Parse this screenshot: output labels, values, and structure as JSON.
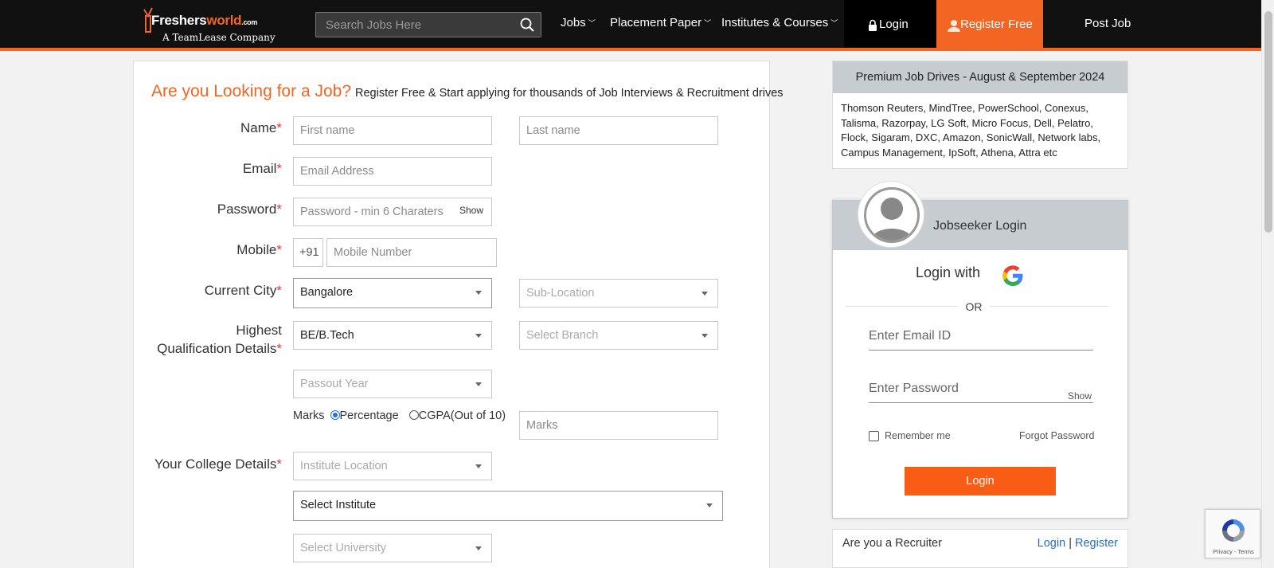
{
  "header": {
    "logo_brand_a": "Freshers",
    "logo_brand_b": "world",
    "logo_brand_c": ".com",
    "logo_tagline": "A TeamLease Company",
    "search_placeholder": "Search Jobs Here",
    "nav": {
      "jobs": "Jobs",
      "placement": "Placement Paper",
      "institutes": "Institutes & Courses",
      "login": "Login",
      "register": "Register Free",
      "post_job": "Post Job"
    },
    "accent_color": "#f26522"
  },
  "form": {
    "headline": "Are you Looking for a Job?",
    "subheadline": "Register Free & Start applying for thousands of Job Interviews & Recruitment drives",
    "required_mark": "*",
    "name_label": "Name",
    "first_name_placeholder": "First name",
    "last_name_placeholder": "Last name",
    "email_label": "Email",
    "email_placeholder": "Email Address",
    "password_label": "Password",
    "password_placeholder": "Password - min 6 Charaters",
    "password_show": "Show",
    "mobile_label": "Mobile",
    "mobile_prefix": "+91",
    "mobile_placeholder": "Mobile Number",
    "city_label": "Current City",
    "city_value": "Bangalore",
    "sublocation_placeholder": "Sub-Location",
    "qualification_label_1": "Highest",
    "qualification_label_2": "Qualification Details",
    "qualification_value": "BE/B.Tech",
    "branch_placeholder": "Select Branch",
    "passout_placeholder": "Passout Year",
    "marks_label": "Marks",
    "marks_option_percentage": "Percentage",
    "marks_option_cgpa": "CGPA(Out of 10)",
    "marks_selected": "Percentage",
    "marks_placeholder": "Marks",
    "college_label": "Your College Details",
    "institute_location_placeholder": "Institute Location",
    "institute_value": "Select Institute",
    "university_placeholder": "Select University"
  },
  "sidebar": {
    "drives_title": "Premium Job Drives - August & September 2024",
    "drives_text": "Thomson Reuters, MindTree, PowerSchool, Conexus, Talisma, Razorpay, LG Soft, Micro Focus, Dell, Pelatro, Flock, Sigaram, DXC, Amazon, SonicWall, Network labs, Campus Management, IpSoft, Athena, Attra etc",
    "login_title": "Jobseeker Login",
    "login_with": "Login with",
    "or": "OR",
    "email_placeholder": "Enter Email ID",
    "password_placeholder": "Enter Password",
    "password_show": "Show",
    "remember": "Remember me",
    "forgot": "Forgot Password",
    "login_button": "Login",
    "recruiter_question": "Are you a Recruiter",
    "recruiter_login": "Login",
    "recruiter_sep": "|",
    "recruiter_register": "Register"
  },
  "recaptcha": {
    "text": "Privacy - Terms"
  }
}
